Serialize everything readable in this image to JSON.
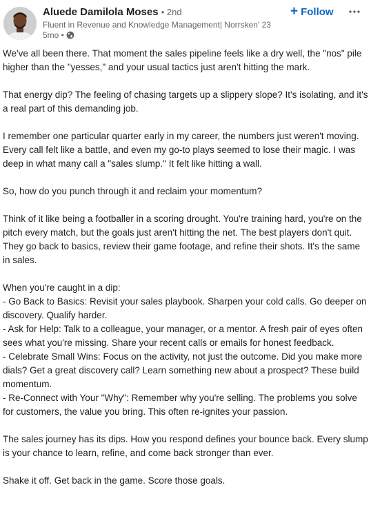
{
  "author": {
    "name": "Aluede Damilola Moses",
    "degree": "• 2nd",
    "headline": "Fluent in Revenue and Knowledge Management| Norrsken' 23",
    "time": "5mo •",
    "visibility_icon": "globe-icon"
  },
  "actions": {
    "follow_icon": "+",
    "follow_label": "Follow",
    "more_icon": "ellipsis-icon"
  },
  "post": {
    "p1": "We've all been there. That moment the sales pipeline feels like a dry well, the \"nos\" pile higher than the \"yesses,\" and your usual tactics just aren't hitting the mark.",
    "p2": "That energy dip? The feeling of chasing targets up a slippery slope? It's isolating, and it's a real part of this demanding job.",
    "p3": "I remember one particular quarter early in my career, the numbers just weren't moving. Every call felt like a battle, and even my go-to plays seemed to lose their magic. I was deep in what many call a \"sales slump.\" It felt like hitting a wall.",
    "p4": "So, how do you punch through it and reclaim your momentum?",
    "p5": "Think of it like being a footballer in a scoring drought. You're training hard, you're on the pitch every match, but the goals just aren't hitting the net. The best players don't quit. They go back to basics, review their game footage, and refine their shots. It's the same in sales.",
    "list_intro": "When you're caught in a dip:",
    "list_items": [
      "- Go Back to Basics: Revisit your sales playbook. Sharpen your cold calls. Go deeper on discovery. Qualify harder.",
      "- Ask for Help: Talk to a colleague, your manager, or a mentor. A fresh pair of eyes often sees what you're missing. Share your recent calls or emails for honest feedback.",
      "- Celebrate Small Wins: Focus on the activity, not just the outcome. Did you make more dials? Get a great discovery call? Learn something new about a prospect? These build momentum.",
      "- Re-Connect with Your \"Why\": Remember why you're selling. The problems you solve for customers, the value you bring. This often re-ignites your passion."
    ],
    "p6": "The sales journey has its dips. How you respond defines your bounce back. Every slump is your chance to learn, refine, and come back stronger than ever.",
    "p7": "Shake it off. Get back in the game. Score those goals."
  },
  "colors": {
    "accent": "#0a66c2",
    "text": "#1f1f1f",
    "muted": "#666666"
  }
}
